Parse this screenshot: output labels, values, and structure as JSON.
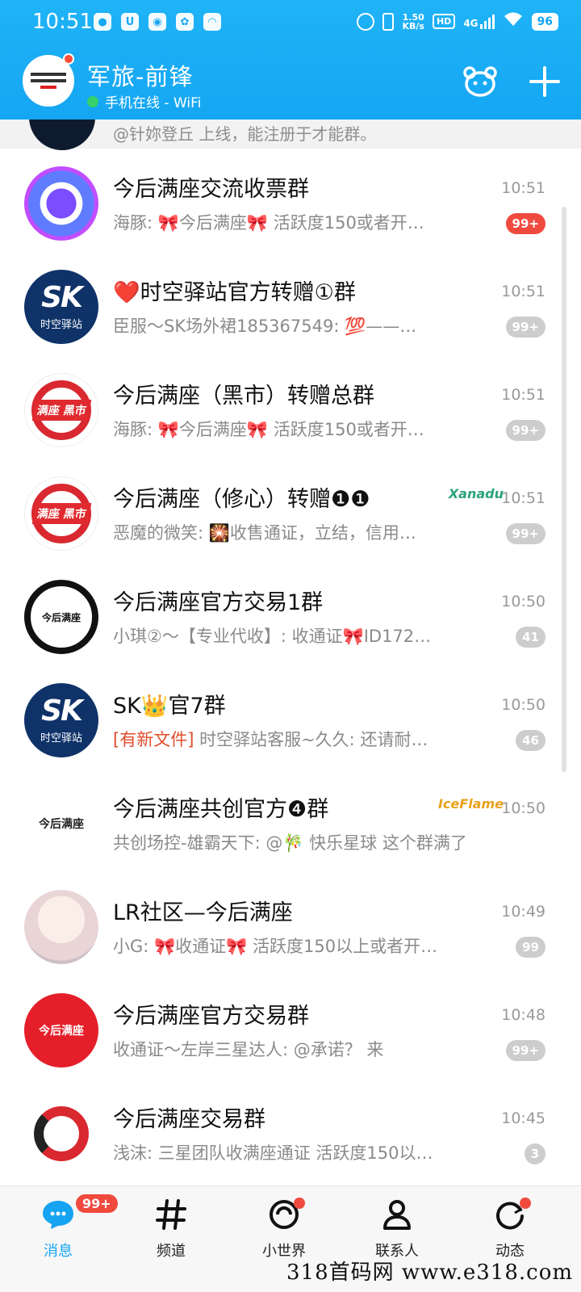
{
  "status_bar": {
    "time": "10:51",
    "net_speed_value": "1.50",
    "net_speed_unit": "KB/s",
    "hd": "HD",
    "network": "4G",
    "battery": "96"
  },
  "header": {
    "name": "军旅-前锋",
    "status": "手机在线 - WiFi"
  },
  "pinned_preview": "@针妳登丘 上线，能注册于才能群。",
  "chats": [
    {
      "title": "今后满座交流收票群",
      "preview": "海豚: 🎀今后满座🎀 活跃度150或者开…",
      "time": "10:51",
      "badge": "99+",
      "badge_style": "red"
    },
    {
      "title": "❤️时空驿站官方转赠①群",
      "preview": "臣服～SK场外裙185367549: 💯——…",
      "time": "10:51",
      "badge": "99+",
      "badge_style": "gray"
    },
    {
      "title": "今后满座（黑市）转赠总群",
      "preview": "海豚: 🎀今后满座🎀 活跃度150或者开…",
      "time": "10:51",
      "badge": "99+",
      "badge_style": "gray"
    },
    {
      "title": "今后满座（修心）转赠❶❶",
      "preview": "恶魔的微笑: 🎇收售通证，立结，信用…",
      "time": "10:51",
      "badge": "99+",
      "badge_style": "gray",
      "tag": "Xanadu"
    },
    {
      "title": "今后满座官方交易1群",
      "preview": "小琪②～【专业代收】: 收通证🎀ID172…",
      "time": "10:50",
      "badge": "41",
      "badge_style": "gray"
    },
    {
      "title": "SK👑官7群",
      "preview_highlight": "[有新文件]",
      "preview": " 时空驿站客服~久久: 还请耐…",
      "time": "10:50",
      "badge": "46",
      "badge_style": "gray"
    },
    {
      "title": "今后满座共创官方❹群",
      "preview": "共创场控-雄霸天下: @🎋 快乐星球 这个群满了",
      "time": "10:50",
      "tag": "IceFlame"
    },
    {
      "title": "LR社区—今后满座",
      "preview": "小G: 🎀收通证🎀 活跃度150以上或者开…",
      "time": "10:49",
      "badge": "99",
      "badge_style": "gray"
    },
    {
      "title": "今后满座官方交易群",
      "preview": "收通证～左岸三星达人: @承诺？ 来",
      "time": "10:48",
      "badge": "99+",
      "badge_style": "gray"
    },
    {
      "title": "今后满座交易群",
      "preview": "浅沫: 三星团队收满座通证  活跃度150以…",
      "time": "10:45",
      "badge": "3",
      "badge_style": "gray"
    }
  ],
  "avatar_labels": {
    "sk_main": "SK",
    "sk_sub": "时空驿站",
    "film_a": "满座 黑市",
    "ring": "今后满座",
    "plain": "今后满座",
    "red": "今后满座"
  },
  "bottom_nav": [
    {
      "label": "消息",
      "badge": "99+"
    },
    {
      "label": "频道"
    },
    {
      "label": "小世界"
    },
    {
      "label": "联系人"
    },
    {
      "label": "动态"
    }
  ],
  "watermark": "318首码网 www.e318.com",
  "colors": {
    "header_blue": "#15a6f3",
    "badge_red": "#f04a3e",
    "active_blue": "#16a4f2"
  }
}
